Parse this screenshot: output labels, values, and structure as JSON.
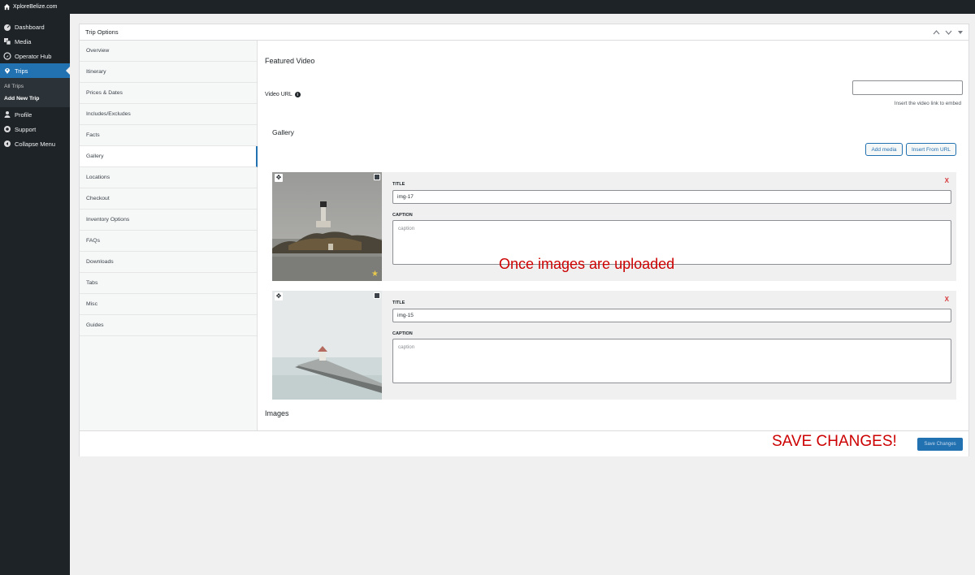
{
  "adminbar": {
    "site_name": "XploreBelize.com"
  },
  "sidebar": {
    "items": [
      {
        "label": "Dashboard",
        "icon": "dashboard-icon"
      },
      {
        "label": "Media",
        "icon": "media-icon"
      },
      {
        "label": "Operator Hub",
        "icon": "operator-hub-icon"
      },
      {
        "label": "Trips",
        "icon": "location-pin-icon"
      }
    ],
    "submenu": [
      {
        "label": "All Trips"
      },
      {
        "label": "Add New Trip"
      }
    ],
    "items_after": [
      {
        "label": "Profile",
        "icon": "user-icon"
      },
      {
        "label": "Support",
        "icon": "lifebuoy-icon"
      },
      {
        "label": "Collapse Menu",
        "icon": "collapse-icon"
      }
    ]
  },
  "panel": {
    "title": "Trip Options"
  },
  "tabs": [
    "Overview",
    "Itinerary",
    "Prices & Dates",
    "Includes/Excludes",
    "Facts",
    "Gallery",
    "Locations",
    "Checkout",
    "Inventory Options",
    "FAQs",
    "Downloads",
    "Tabs",
    "Misc",
    "Guides"
  ],
  "featured_video": {
    "heading": "Featured Video",
    "label": "Video URL",
    "info_glyph": "i",
    "value": "",
    "hint": "Insert the video link to embed"
  },
  "gallery": {
    "heading": "Gallery",
    "add_media": "Add media",
    "insert_url": "Insert From URL",
    "title_label": "TITLE",
    "caption_label": "CAPTION",
    "caption_placeholder": "caption",
    "remove": "X",
    "move_glyph": "✥",
    "star_glyph": "★",
    "items": [
      {
        "title": "img-17",
        "image": "lighthouse-island",
        "featured": true
      },
      {
        "title": "img-15",
        "image": "pier-gazebo",
        "featured": false
      }
    ]
  },
  "images_heading": "Images",
  "footer": {
    "save_label": "Save Changes"
  },
  "annotations": {
    "uploaded_note": "Once images are uploaded",
    "save_note": "SAVE CHANGES!"
  }
}
